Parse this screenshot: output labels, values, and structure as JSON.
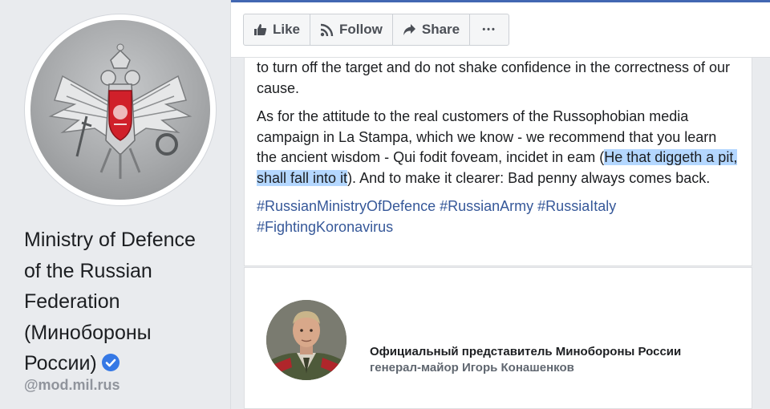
{
  "profile": {
    "name": "Ministry of Defence of the Russian Federation (Минобороны России)",
    "name_lines": [
      "Ministry of Defence",
      "of the Russian",
      "Federation",
      "(Минобороны",
      "России)"
    ],
    "handle": "@mod.mil.rus",
    "avatar_icon": "double-headed-eagle-emblem",
    "verified_icon": "verified-check-icon"
  },
  "actions": {
    "like_label": "Like",
    "follow_label": "Follow",
    "share_label": "Share",
    "more_label": "•••"
  },
  "post": {
    "para1": "to turn off the target and do not shake confidence in the correctness of our cause.",
    "para2_before": "As for the attitude to the real customers of the Russophobian media campaign in La Stampa, which we know - we recommend that you learn the ancient wisdom - Qui fodit foveam, incidet in eam (",
    "para2_highlight": "He that diggeth a pit, shall fall into it",
    "para2_after": "). And to make it clearer: Bad penny always comes back.",
    "hashtags": [
      "#RussianMinistryOfDefence",
      "#RussianArmy",
      "#RussiaItaly",
      "#FightingKoronavirus"
    ]
  },
  "attachment": {
    "title": "Официальный представитель Минобороны России",
    "subtitle": "генерал-майор  Игорь Конашенков"
  },
  "colors": {
    "accent": "#4267b2",
    "link": "#365899",
    "highlight": "#b4d7ff",
    "verified": "#3578e5"
  }
}
